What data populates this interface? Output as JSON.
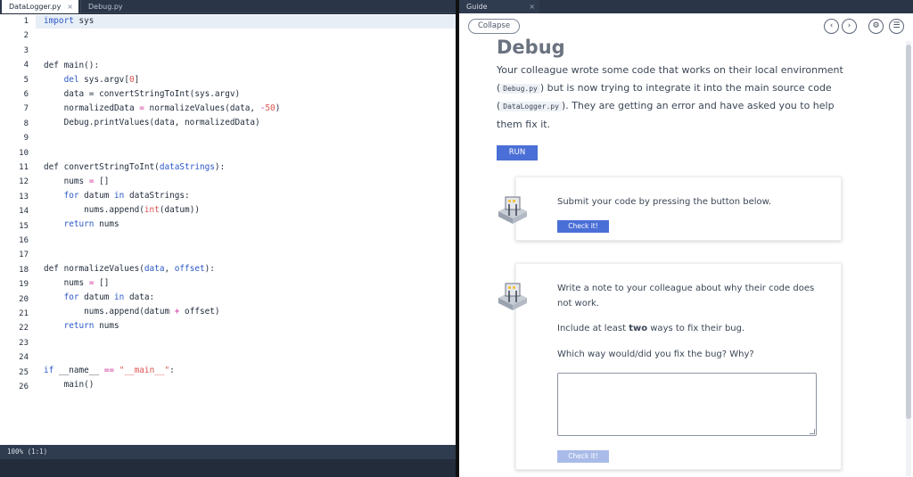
{
  "editor": {
    "tabs": [
      {
        "label": "DataLogger.py",
        "close": "×"
      },
      {
        "label": "Debug.py"
      }
    ],
    "status": "100% (1:1)",
    "lines": [
      "1",
      "2",
      "3",
      "4",
      "5",
      "6",
      "7",
      "8",
      "9",
      "10",
      "11",
      "12",
      "13",
      "14",
      "15",
      "16",
      "17",
      "18",
      "19",
      "20",
      "21",
      "22",
      "23",
      "24",
      "25",
      "26"
    ]
  },
  "guide": {
    "tab_label": "Guide",
    "tab_close": "×",
    "collapse": "Collapse",
    "nav": {
      "prev": "‹",
      "next": "›",
      "settings": "⚙",
      "menu": "☰"
    },
    "title": "Debug",
    "para_1": "Your colleague wrote some code that works on their local environment",
    "code_1": "Debug.py",
    "para_2": " but is now trying to integrate it into the main source code",
    "code_2": "DataLogger.py",
    "para_3": ". They are getting an error and have asked you to help them fix it.",
    "run": "RUN",
    "card1": {
      "text": "Submit your code by pressing the button below.",
      "button": "Check it!"
    },
    "card2": {
      "text1": "Write a note to your colleague about why their code does not work.",
      "text2a": "Include at least ",
      "text2b": "two",
      "text2c": " ways to fix their bug.",
      "text3": "Which way would/did you fix the bug? Why?",
      "button": "Check it!"
    }
  }
}
